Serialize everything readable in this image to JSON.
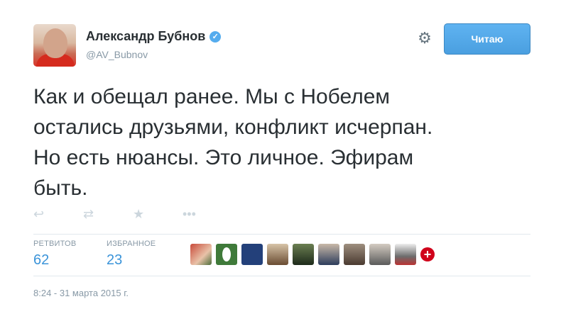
{
  "header": {
    "display_name": "Александр Бубнов",
    "verified_icon": "verified-badge-icon",
    "handle": "@AV_Bubnov",
    "follow_label": "Читаю",
    "gear_icon": "gear-icon"
  },
  "tweet": {
    "text": "Как и обещал ранее. Мы с Нобелем\nостались друзьями, конфликт исчерпан.\nНо есть нюансы. Это личное. Эфирам\nбыть."
  },
  "actions": [
    {
      "name": "reply-icon",
      "glyph": "↩"
    },
    {
      "name": "retweet-icon",
      "glyph": "⇄"
    },
    {
      "name": "favorite-icon",
      "glyph": "★"
    },
    {
      "name": "more-icon",
      "glyph": "•••"
    }
  ],
  "stats": {
    "retweets_label": "РЕТВИТОВ",
    "retweets_value": "62",
    "favorites_label": "ИЗБРАННОЕ",
    "favorites_value": "23"
  },
  "timestamp": "8:24 - 31 марта 2015 г.",
  "colors": {
    "accent": "#55acee",
    "stat_value": "#3b94d9",
    "muted": "#8899a6"
  }
}
